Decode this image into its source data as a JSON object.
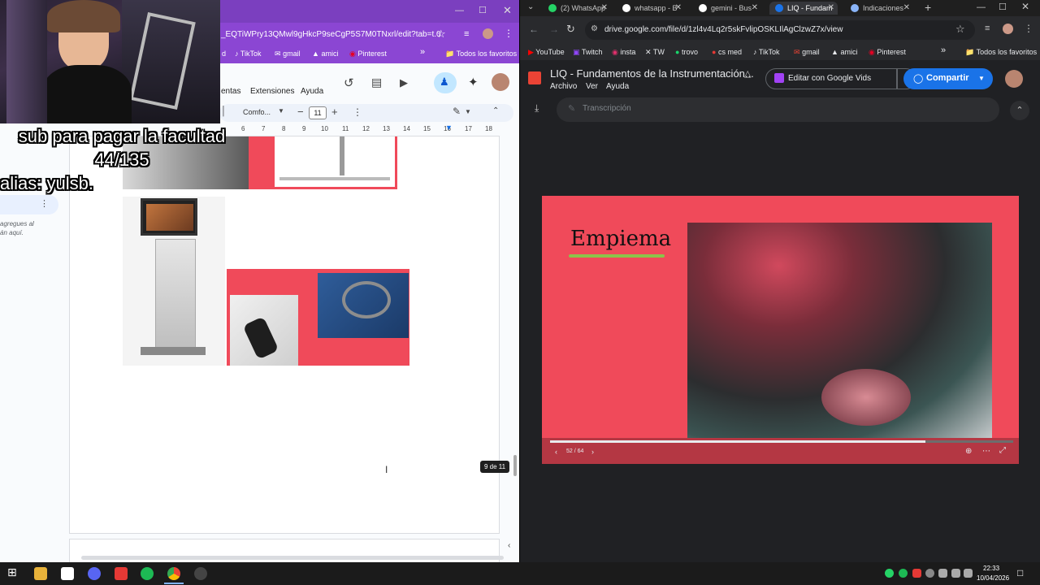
{
  "left": {
    "url": "_EQTiWPry13QMwl9gHkcP9seCgP5S7M0TNxrl/edit?tab=t.0",
    "bookmarks": [
      "d",
      "TikTok",
      "gmail",
      "amici",
      "Pinterest"
    ],
    "all_bookmarks": "Todos los favoritos",
    "menu": [
      "entas",
      "Extensiones",
      "Ayuda"
    ],
    "toolbar": {
      "style": "Comfo...",
      "font_size": "11"
    },
    "ruler": [
      "6",
      "7",
      "8",
      "9",
      "10",
      "11",
      "12",
      "13",
      "14",
      "15",
      "16",
      "17",
      "18"
    ],
    "overlay": [
      "sub para pagar la facultad",
      "44/135",
      "alias: yulsb."
    ],
    "comment_hint": "agregues al\nán aquí.",
    "page_indicator": "9 de 11"
  },
  "right": {
    "tabs": [
      {
        "label": "(2) WhatsApp",
        "color": "#25d366"
      },
      {
        "label": "whatsapp - B",
        "color": "#4285f4"
      },
      {
        "label": "gemini - Bus",
        "color": "#4285f4"
      },
      {
        "label": "LIQ - Fundam",
        "color": "#1a73e8",
        "active": true
      },
      {
        "label": "Indicaciones",
        "color": "#8ab4f8"
      }
    ],
    "url": "drive.google.com/file/d/1zl4v4Lq2r5skFvlipOSKLIlAgClzwZ7x/view",
    "bookmarks": [
      "YouTube",
      "Twitch",
      "insta",
      "TW",
      "trovo",
      "cs med",
      "TikTok",
      "gmail",
      "amici",
      "Pinterest"
    ],
    "all_bookmarks": "Todos los favoritos",
    "file_title": "LIQ - Fundamentos de la Instrumentación...",
    "menu": [
      "Archivo",
      "Ver",
      "Ayuda"
    ],
    "edit_button": "Editar con Google Vids",
    "share_button": "Compartir",
    "transcription": "Transcripción",
    "slide_title": "Empiema",
    "slide_counter": "52 / 64",
    "progress": 0.81
  },
  "taskbar": {
    "time": "22:33",
    "date": "10/04/2026"
  }
}
